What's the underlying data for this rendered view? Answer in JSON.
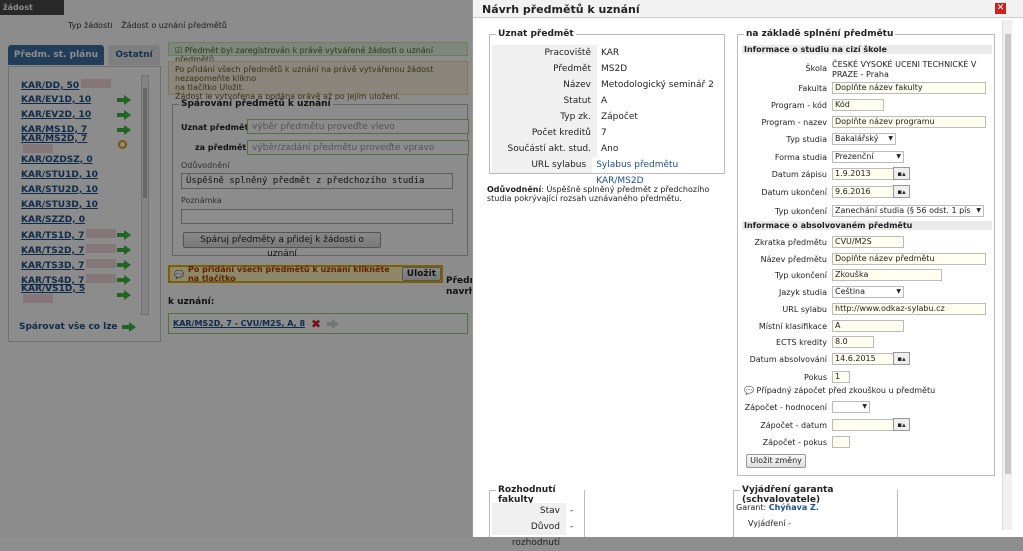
{
  "app_title": "žádost studenta",
  "breadcrumbs": [
    "Typ žádosti",
    "Žádost o uznání předmětů"
  ],
  "left_tabs": {
    "active": "Předm. st. plánu",
    "other": "Ostatní"
  },
  "subjects": [
    {
      "label": "KAR/DD, 50",
      "bar": true,
      "icon": "none"
    },
    {
      "label": "KAR/EV1D, 10",
      "bar": false,
      "icon": "arrow"
    },
    {
      "label": "KAR/EV2D, 10",
      "bar": false,
      "icon": "arrow"
    },
    {
      "label": "KAR/MS1D, 7",
      "bar": false,
      "icon": "arrow"
    },
    {
      "label": "KAR/MS2D, 7",
      "bar": true,
      "icon": "ban"
    },
    {
      "label": "KAR/OZDSZ, 0",
      "bar": false,
      "icon": "none"
    },
    {
      "label": "KAR/STU1D, 10",
      "bar": false,
      "icon": "none"
    },
    {
      "label": "KAR/STU2D, 10",
      "bar": false,
      "icon": "none"
    },
    {
      "label": "KAR/STU3D, 10",
      "bar": false,
      "icon": "none"
    },
    {
      "label": "KAR/SZZD, 0",
      "bar": false,
      "icon": "none"
    },
    {
      "label": "KAR/TS1D, 7",
      "bar": true,
      "icon": "arrow"
    },
    {
      "label": "KAR/TS2D, 7",
      "bar": true,
      "icon": "arrow"
    },
    {
      "label": "KAR/TS3D, 7",
      "bar": true,
      "icon": "arrow"
    },
    {
      "label": "KAR/TS4D, 7",
      "bar": true,
      "icon": "arrow"
    },
    {
      "label": "KAR/VS1D, 5",
      "bar": true,
      "icon": "arrow"
    }
  ],
  "pair_all": "Spárovat vše co lze",
  "msg_green": "Předmět byl zaregistrován k právě vytvářené žádosti o uznání předmětů.",
  "msg_yellow_1": "Po přidání všech předmětů k uznání na právě vytvářenou žádost nezapomeňte klikno",
  "msg_yellow_2": "na tlačítko Uložit.",
  "msg_yellow_3": "Žádost je vytvořena a podána právě až po jejím uložení.",
  "pairing": {
    "legend": "Spárování předmětů k uznání",
    "uznat_label": "Uznat předmět",
    "uznat_placeholder": "výběr předmětu proveďte vlevo",
    "za_label": "za předmět",
    "za_placeholder": "výběr/zadání předmětu proveďte vpravo",
    "oduvodneni_label": "Odůvodnění",
    "oduvodneni_value": "Úspěšně splněný předmět z předchozího studia",
    "poznamka_label": "Poznámka",
    "button": "Spáruj předměty a přidej k žádosti o uznání"
  },
  "save_hint": "Po přidání všech předmětů k uznání klikněte na tlačítko",
  "save_button": "Uložit",
  "behind_pred": "Předm",
  "behind_navrh": "navrh",
  "to_recognize_label": "k uznání:",
  "record": "KAR/MS2D, 7 - CVU/M2S, A, 8",
  "dialog": {
    "title": "Návrh předmětů k uznání",
    "left_legend": "Uznat předmět",
    "rows": [
      {
        "k": "Pracoviště",
        "v": "KAR"
      },
      {
        "k": "Předmět",
        "v": "MS2D"
      },
      {
        "k": "Název",
        "v": "Metodologický seminář 2"
      },
      {
        "k": "Statut",
        "v": "A"
      },
      {
        "k": "Typ zk.",
        "v": "Zápočet"
      },
      {
        "k": "Počet kreditů",
        "v": "7"
      },
      {
        "k": "Součástí akt. stud. plánu",
        "v": "Ano"
      },
      {
        "k": "URL sylabus",
        "v": "Sylabus předmětu KAR/MS2D"
      }
    ],
    "reason_label": "Odůvodnění",
    "reason_text_1": ": Úspěšně splněný předmět z předchozího",
    "reason_text_2": "studia pokrývající rozsah uznávaného předmětu.",
    "right_legend": "na základě splnění předmětu",
    "sec1": "Informace o studiu na cizí škole",
    "skola_label": "Škola",
    "skola_value_1": "ČESKÉ VYSOKÉ UCENI TECHNICKÉ V",
    "skola_value_2": "PRAZE - Praha",
    "fakulta_label": "Fakulta",
    "fakulta_value": "Doplňte název fakulty",
    "prog_kod_label": "Program - kód",
    "prog_kod_value": "Kód",
    "prog_nazev_label": "Program - nazev",
    "prog_nazev_value": "Doplňte název programu",
    "typ_studia_label": "Typ studia",
    "typ_studia_value": "Bakalářský",
    "forma_label": "Forma studia",
    "forma_value": "Prezenční",
    "zapis_label": "Datum zápisu",
    "zapis_value": "1.9.2013",
    "ukonc_label": "Datum ukončení",
    "ukonc_value": "9.6.2016",
    "typ_ukonc_label": "Typ ukončení",
    "typ_ukonc_value": "Zanechání studia (§ 56 odst. 1 pís",
    "sec2": "Informace o absolvovaném předmětu",
    "zkratka_label": "Zkratka předmětu",
    "zkratka_value": "CVU/M2S",
    "nazev_label": "Název předmětu",
    "nazev_value": "Doplňte název předmětu",
    "typ_uk_label": "Typ ukončení",
    "typ_uk_value": "Zkouška",
    "jazyk_label": "Jazyk studia",
    "jazyk_value": "Čeština",
    "url_label": "URL sylabu",
    "url_value": "http://www.odkaz-sylabu.cz",
    "mistni_label": "Místní klasifikace",
    "mistni_value": "A",
    "ects_label": "ECTS kredity",
    "ects_value": "8.0",
    "absolv_label": "Datum absolvování",
    "absolv_value": "14.6.2015",
    "pokus_label": "Pokus",
    "pokus_value": "1",
    "zapocet_note": "Případný zápočet před zkouškou u předmětu",
    "zap_hod_label": "Zápočet - hodnocení",
    "zap_dat_label": "Zápočet - datum",
    "zap_pok_label": "Zápočet - pokus",
    "save_changes": "Uložit změny",
    "fac_legend": "Rozhodnutí fakulty",
    "stav_label": "Stav",
    "stav_value": "-",
    "duvod_label": "Důvod rozhodnutí",
    "duvod_value": "-",
    "garant_legend": "Vyjádření garanta (schvalovatele)",
    "garant_label": "Garant:",
    "garant_value": "Chýňava Z.",
    "vyjadreni_label": "Vyjádření",
    "vyjadreni_value": "-"
  }
}
